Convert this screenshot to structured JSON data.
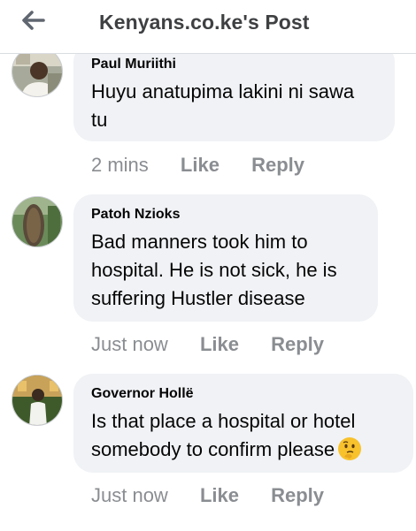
{
  "header": {
    "title": "Kenyans.co.ke's Post",
    "back_icon": "back-arrow-icon"
  },
  "comments": [
    {
      "author": "Paul Muriithi",
      "text_lines": [
        "Huyu anatupima lakini ni sawa",
        "tu"
      ],
      "time": "2 mins",
      "like": "Like",
      "reply": "Reply"
    },
    {
      "author": "Patoh Nzioks",
      "text_lines": [
        "Bad manners took him to",
        "hospital. He is not sick, he is",
        "suffering Hustler disease"
      ],
      "time": "Just now",
      "like": "Like",
      "reply": "Reply"
    },
    {
      "author": "Governor Hollë",
      "text_lines": [
        "Is that place a hospital or hotel",
        "somebody to confirm please"
      ],
      "emoji": "thinking-face-icon",
      "time": "Just now",
      "like": "Like",
      "reply": "Reply"
    }
  ],
  "colors": {
    "bubble": "#f0f2f5",
    "meta_text": "#8a8d91",
    "title": "#3e4042"
  }
}
